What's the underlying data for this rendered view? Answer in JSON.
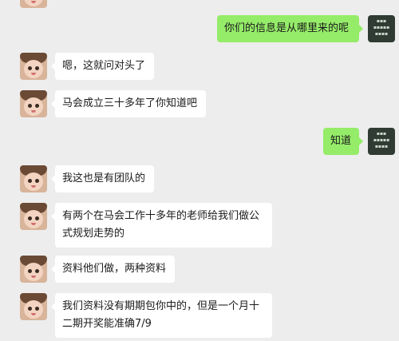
{
  "colors": {
    "background": "#ededed",
    "incoming_bubble": "#ffffff",
    "outgoing_bubble": "#95ec69"
  },
  "self_avatar_icon": "self-avatar-icon",
  "contact_avatar_icon": "girl-avatar-icon",
  "messages": [
    {
      "sender": "self",
      "text": "你们的信息是从哪里来的呢"
    },
    {
      "sender": "contact",
      "text": "嗯，这就问对头了"
    },
    {
      "sender": "contact",
      "text": "马会成立三十多年了你知道吧"
    },
    {
      "sender": "self",
      "text": "知道"
    },
    {
      "sender": "contact",
      "text": "我这也是有团队的"
    },
    {
      "sender": "contact",
      "text": "有两个在马会工作十多年的老师给我们做公式规划走势的"
    },
    {
      "sender": "contact",
      "text": "资料他们做，两种资料"
    },
    {
      "sender": "contact",
      "text": "我们资料没有期期包你中的，但是一个月十二期开奖能准确7/9"
    }
  ]
}
